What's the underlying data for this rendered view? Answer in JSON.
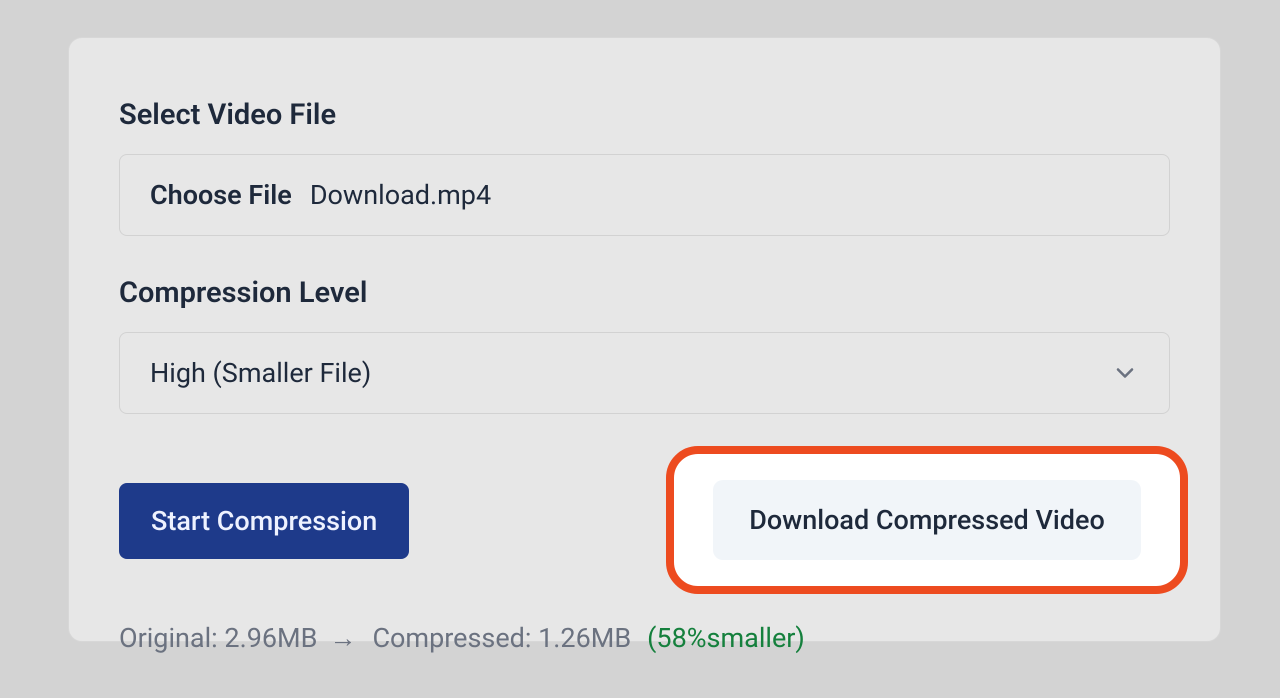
{
  "fileSection": {
    "label": "Select Video File",
    "chooseButton": "Choose File",
    "fileName": "Download.mp4"
  },
  "compressionSection": {
    "label": "Compression Level",
    "selectedOption": "High (Smaller File)"
  },
  "buttons": {
    "start": "Start Compression",
    "download": "Download Compressed Video"
  },
  "stats": {
    "originalText": "Original: 2.96MB",
    "arrow": "→",
    "compressedText": "Compressed: 1.26MB",
    "smallerText": "(58%smaller)"
  }
}
